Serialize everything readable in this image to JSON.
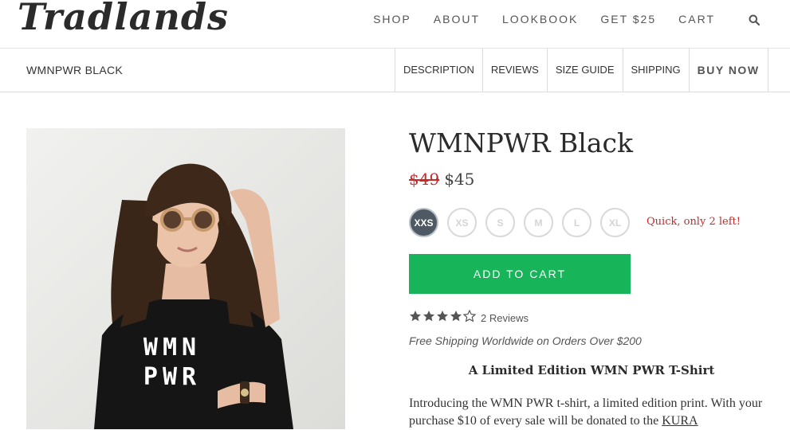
{
  "brand": {
    "logo_text": "Tradlands"
  },
  "nav": {
    "items": [
      "SHOP",
      "ABOUT",
      "LOOKBOOK",
      "GET $25",
      "CART"
    ],
    "search_icon": "search-icon"
  },
  "subnav": {
    "breadcrumb": "WMNPWR BLACK",
    "tabs": [
      "DESCRIPTION",
      "REVIEWS",
      "SIZE GUIDE",
      "SHIPPING",
      "BUY NOW"
    ]
  },
  "product": {
    "title": "WMNPWR Black",
    "old_price": "$49",
    "price": "$45",
    "sizes": [
      "XXS",
      "XS",
      "S",
      "M",
      "L",
      "XL"
    ],
    "selected_size": "XXS",
    "stock_note": "Quick, only 2 left!",
    "add_to_cart": "ADD TO CART",
    "rating": 4.5,
    "reviews_label": "2 Reviews",
    "shipping_note": "Free Shipping Worldwide on Orders Over $200",
    "subheading": "A Limited Edition WMN PWR T-Shirt",
    "description_text": "Introducing the WMN PWR t-shirt, a limited edition print. With your purchase $10 of every sale will be donated to the",
    "description_link": "KURA",
    "shirt_print": [
      "WMN",
      "PWR"
    ]
  },
  "colors": {
    "accent_green": "#17b45a",
    "sale_red": "#c62a2a",
    "selected_size": "#4f5963"
  }
}
